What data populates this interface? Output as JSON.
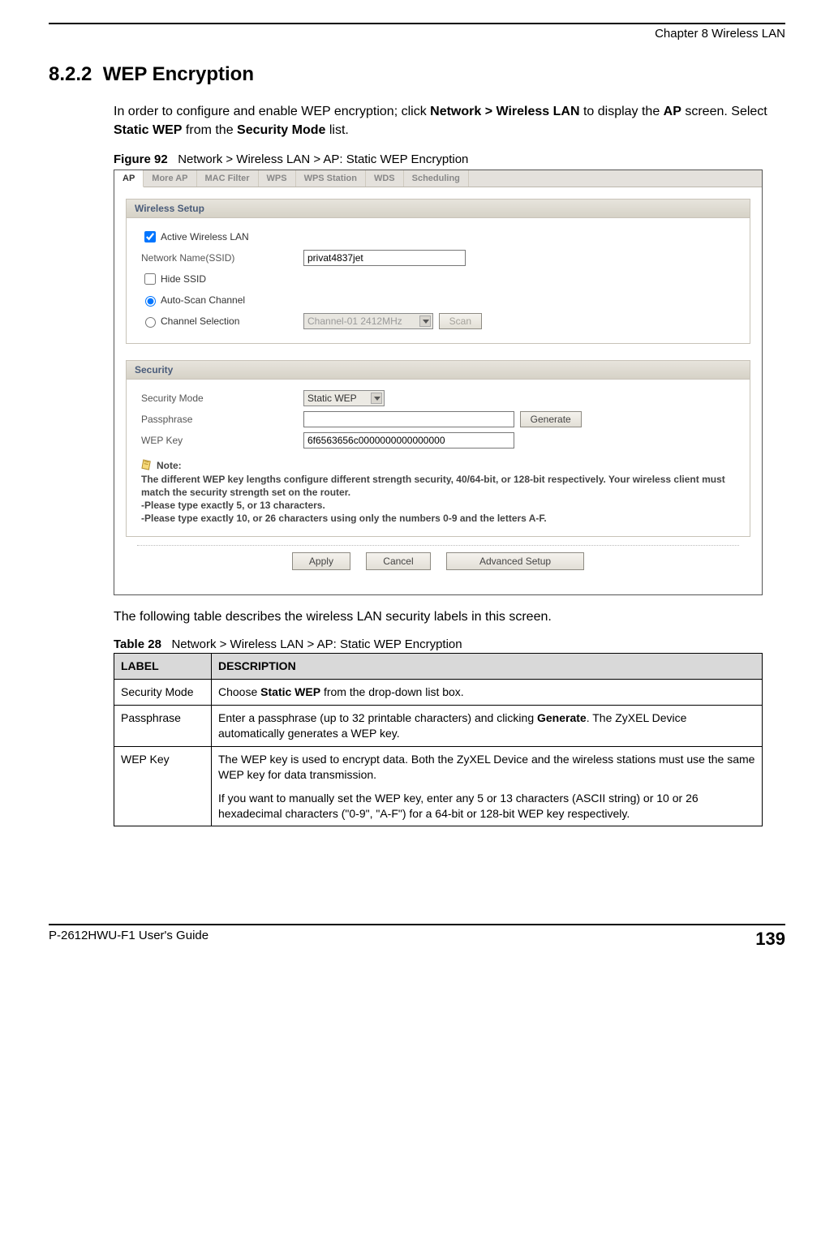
{
  "chapter_header": "Chapter 8 Wireless LAN",
  "section_number": "8.2.2",
  "section_title": "WEP Encryption",
  "intro_segments": [
    {
      "t": "In order to configure and enable WEP encryption; click "
    },
    {
      "t": "Network > Wireless LAN",
      "b": true
    },
    {
      "t": " to display the "
    },
    {
      "t": "AP",
      "b": true
    },
    {
      "t": " screen. Select "
    },
    {
      "t": "Static WEP",
      "b": true
    },
    {
      "t": " from the "
    },
    {
      "t": "Security Mode",
      "b": true
    },
    {
      "t": " list."
    }
  ],
  "figure_label": "Figure 92",
  "figure_title": "Network > Wireless LAN > AP: Static WEP Encryption",
  "shot": {
    "tabs": [
      "AP",
      "More AP",
      "MAC Filter",
      "WPS",
      "WPS Station",
      "WDS",
      "Scheduling"
    ],
    "wireless_setup_title": "Wireless Setup",
    "active_wlan_label": "Active Wireless LAN",
    "active_wlan_checked": true,
    "ssid_label": "Network Name(SSID)",
    "ssid_value": "privat4837jet",
    "hide_ssid_label": "Hide SSID",
    "hide_ssid_checked": false,
    "auto_scan_label": "Auto-Scan Channel",
    "chan_sel_label": "Channel Selection",
    "chan_value": "Channel-01 2412MHz",
    "scan_btn": "Scan",
    "security_title": "Security",
    "sec_mode_label": "Security Mode",
    "sec_mode_value": "Static WEP",
    "passphrase_label": "Passphrase",
    "passphrase_value": "",
    "generate_btn": "Generate",
    "wep_key_label": "WEP Key",
    "wep_key_value": "6f6563656c0000000000000000",
    "note_title": "Note:",
    "note_line1": "The different WEP key lengths configure different strength security, 40/64-bit, or 128-bit respectively. Your wireless client must match the security strength set on the router.",
    "note_line2": "-Please type exactly 5, or 13 characters.",
    "note_line3": "-Please type exactly 10, or 26 characters using only the numbers 0-9 and the letters A-F.",
    "apply_btn": "Apply",
    "cancel_btn": "Cancel",
    "adv_btn": "Advanced Setup"
  },
  "desc_intro": "The following table describes the wireless LAN security labels in this screen.",
  "table_label": "Table 28",
  "table_title": "Network > Wireless LAN > AP: Static WEP Encryption",
  "table_head_label": "LABEL",
  "table_head_desc": "DESCRIPTION",
  "rows": {
    "sec_mode": {
      "label": "Security Mode",
      "segs": [
        {
          "t": "Choose "
        },
        {
          "t": "Static WEP",
          "b": true
        },
        {
          "t": " from the drop-down list box."
        }
      ]
    },
    "passphrase": {
      "label": "Passphrase",
      "segs": [
        {
          "t": "Enter a passphrase (up to 32 printable characters) and clicking "
        },
        {
          "t": "Generate",
          "b": true
        },
        {
          "t": ". The ZyXEL Device automatically generates a WEP key."
        }
      ]
    },
    "wep_key": {
      "label": "WEP Key",
      "p1": "The WEP key is used to encrypt data. Both the ZyXEL Device and the wireless stations must use the same WEP key for data transmission.",
      "p2": "If you want to manually set the WEP key, enter any 5 or 13 characters (ASCII string) or 10 or 26 hexadecimal characters (\"0-9\", \"A-F\") for a 64-bit or 128-bit WEP key respectively."
    }
  },
  "footer_guide": "P-2612HWU-F1 User's Guide",
  "footer_page": "139"
}
